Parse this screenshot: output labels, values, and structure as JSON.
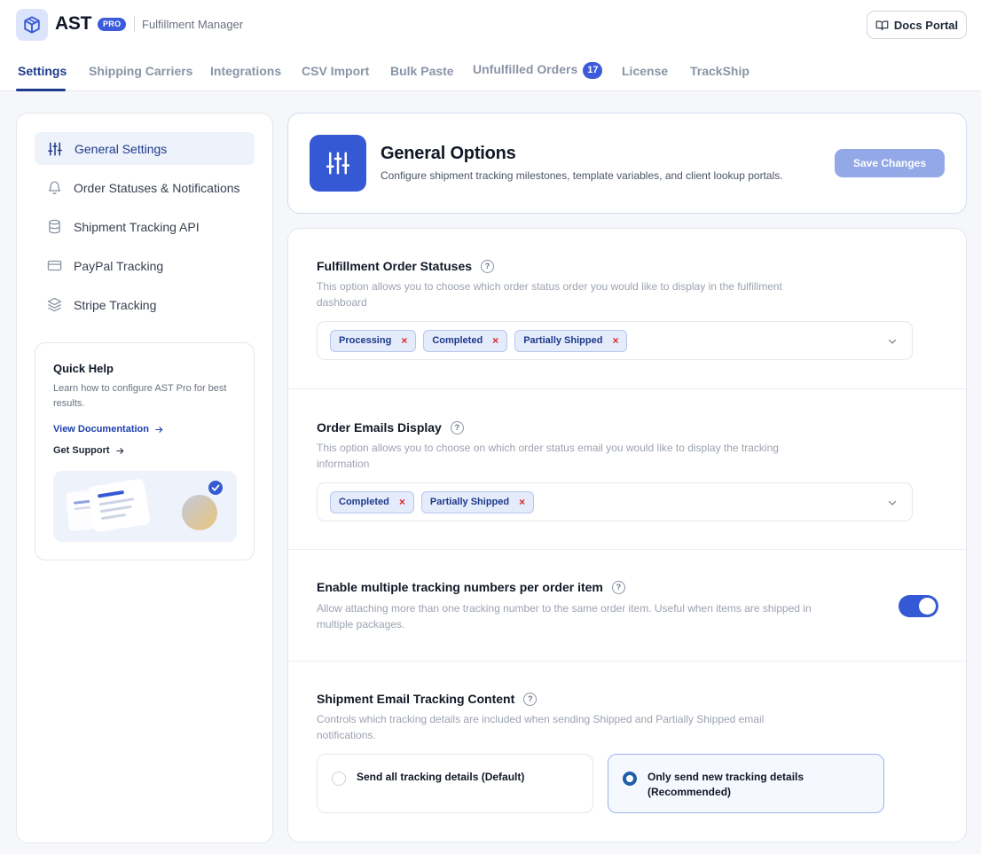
{
  "header": {
    "brand": "AST",
    "badge": "PRO",
    "subtitle": "Fulfillment Manager",
    "docs_button": "Docs Portal"
  },
  "tabs": [
    {
      "label": "Settings",
      "active": true
    },
    {
      "label": "Shipping Carriers"
    },
    {
      "label": "Integrations"
    },
    {
      "label": "CSV Import"
    },
    {
      "label": "Bulk Paste"
    },
    {
      "label": "Unfulfilled Orders",
      "count": "17"
    },
    {
      "label": "License"
    },
    {
      "label": "TrackShip"
    }
  ],
  "sidebar": {
    "items": [
      {
        "label": "General Settings",
        "icon": "sliders-icon",
        "active": true
      },
      {
        "label": "Order Statuses & Notifications",
        "icon": "bell-icon"
      },
      {
        "label": "Shipment Tracking API",
        "icon": "database-icon"
      },
      {
        "label": "PayPal Tracking",
        "icon": "credit-card-icon"
      },
      {
        "label": "Stripe Tracking",
        "icon": "layers-icon"
      }
    ],
    "help": {
      "title": "Quick Help",
      "text": "Learn how to configure AST Pro for best results.",
      "doc_link": "View Documentation",
      "support_link": "Get Support"
    }
  },
  "page_header": {
    "title": "General Options",
    "description": "Configure shipment tracking milestones, template variables, and client lookup portals.",
    "save_button": "Save Changes"
  },
  "settings": {
    "fulfillment_statuses": {
      "title": "Fulfillment Order Statuses",
      "description": "This option allows you to choose which order status order you would like to display in the fulfillment dashboard",
      "selected": [
        "Processing",
        "Completed",
        "Partially Shipped"
      ]
    },
    "order_emails": {
      "title": "Order Emails Display",
      "description": "This option allows you to choose on which order status email you would like to display the tracking information",
      "selected": [
        "Completed",
        "Partially Shipped"
      ]
    },
    "multiple_tracking": {
      "title": "Enable multiple tracking numbers per order item",
      "description": "Allow attaching more than one tracking number to the same order item. Useful when items are shipped in multiple packages.",
      "enabled": true
    },
    "email_tracking_content": {
      "title": "Shipment Email Tracking Content",
      "description": "Controls which tracking details are included when sending Shipped and Partially Shipped email notifications.",
      "options": [
        {
          "label": "Send all tracking details (Default)",
          "selected": false
        },
        {
          "label": "Only send new tracking details (Recommended)",
          "selected": true
        }
      ]
    }
  },
  "colors": {
    "primary": "#3558d4",
    "active_text": "#1e3a8a",
    "chip_remove": "#dc2626"
  }
}
